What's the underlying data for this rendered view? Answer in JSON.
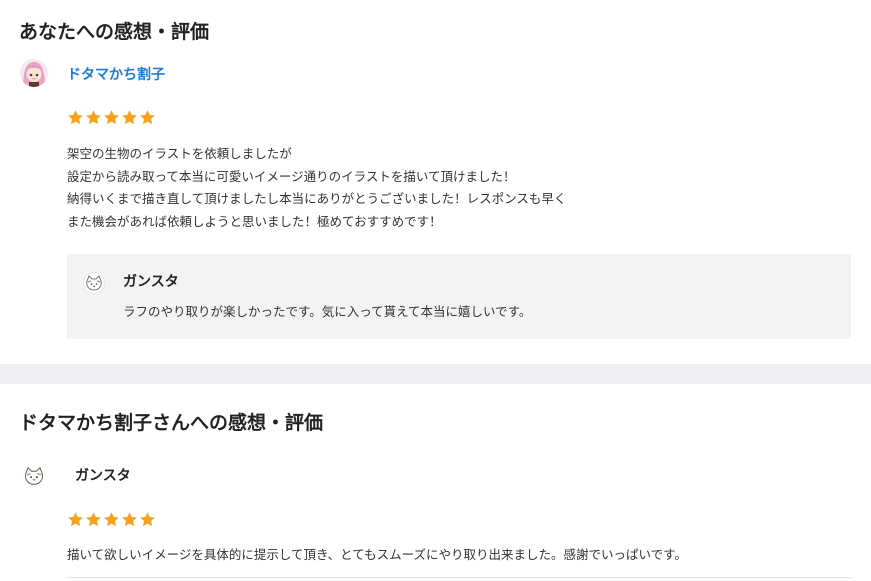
{
  "received_review": {
    "heading": "あなたへの感想・評価",
    "reviewer": {
      "name": "ドタマかち割子",
      "avatar_icon": "anime-girl-avatar-icon"
    },
    "rating": {
      "value": 5,
      "max": 5,
      "color": "#f5a11d"
    },
    "comment_lines": [
      "架空の生物のイラストを依頼しましたが",
      "設定から読み取って本当に可愛いイメージ通りのイラストを描いて頂けました！",
      "納得いくまで描き直して頂けましたし本当にありがとうございました！レスポンスも早く",
      "また機会があれば依頼しようと思いました！極めておすすめです！"
    ],
    "reply": {
      "name": "ガンスタ",
      "avatar_icon": "cat-sketch-avatar-icon",
      "text": "ラフのやり取りが楽しかったです。気に入って貰えて本当に嬉しいです。"
    }
  },
  "given_review": {
    "heading": "ドタマかち割子さんへの感想・評価",
    "reviewer": {
      "name": "ガンスタ",
      "avatar_icon": "cat-sketch-avatar-icon"
    },
    "rating": {
      "value": 5,
      "max": 5,
      "color": "#f5a11d"
    },
    "comment": "描いて欲しいイメージを具体的に提示して頂き、とてもスムーズにやり取り出来ました。感謝でいっぱいです。"
  },
  "colors": {
    "link": "#1e7bd6",
    "star": "#f5a11d",
    "reply_bg": "#f2f3f5",
    "section_gap": "#eef0f3"
  }
}
